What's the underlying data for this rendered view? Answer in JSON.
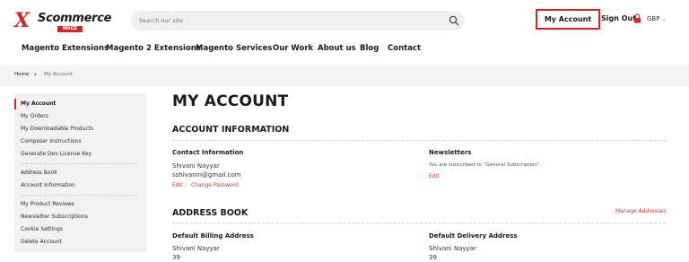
{
  "header": {
    "logo_word": "Scommerce",
    "logo_tag": "MAGE",
    "search_placeholder": "Search our site",
    "my_account": "My Account",
    "sign_out": "Sign Out",
    "currency": "GBP"
  },
  "nav": {
    "items": [
      "Magento Extensions",
      "Magento 2 Extensions",
      "Magento Services",
      "Our Work",
      "About us",
      "Blog",
      "Contact"
    ]
  },
  "breadcrumb": {
    "home": "Home",
    "current": "My Account"
  },
  "sidebar": {
    "group1": [
      "My Account",
      "My Orders",
      "My Downloadable Products",
      "Composer Instructions",
      "Generate Dev License Key"
    ],
    "group2": [
      "Address Book",
      "Account Information"
    ],
    "group3": [
      "My Product Reviews",
      "Newsletter Subscriptions",
      "Cookie Settings",
      "Delete Account"
    ]
  },
  "main": {
    "title": "MY ACCOUNT",
    "account_info": {
      "heading": "ACCOUNT INFORMATION",
      "contact_heading": "Contact Information",
      "name": "Shivani Nayyar",
      "email": "sshivanin@gmail.com",
      "edit": "Edit",
      "change_password": "Change Password",
      "newsletters_heading": "Newsletters",
      "newsletters_text": "You are subscribed to \"General Subscription\".",
      "newsletters_edit": "Edit"
    },
    "address_book": {
      "heading": "ADDRESS BOOK",
      "manage": "Manage Addresses",
      "billing_heading": "Default Billing Address",
      "billing_name": "Shivani Nayyar",
      "billing_line": "39",
      "delivery_heading": "Default Delivery Address",
      "delivery_name": "Shivani Nayyar",
      "delivery_line": "39"
    }
  },
  "colors": {
    "brand_red": "#c92a2a",
    "highlight_border": "#e02020",
    "link": "#c0392b"
  }
}
